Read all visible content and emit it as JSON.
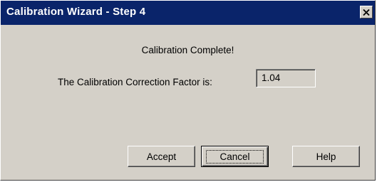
{
  "window": {
    "title": "Calibration Wizard - Step 4",
    "close_icon": "close-x-icon",
    "titlebar_color": "#0a246a",
    "face_color": "#d4d0c8"
  },
  "content": {
    "status_message": "Calibration Complete!",
    "factor_label": "The Calibration Correction Factor is:",
    "factor_value": "1.04"
  },
  "buttons": {
    "accept_label": "Accept",
    "cancel_label": "Cancel",
    "help_label": "Help",
    "focused": "Cancel"
  }
}
